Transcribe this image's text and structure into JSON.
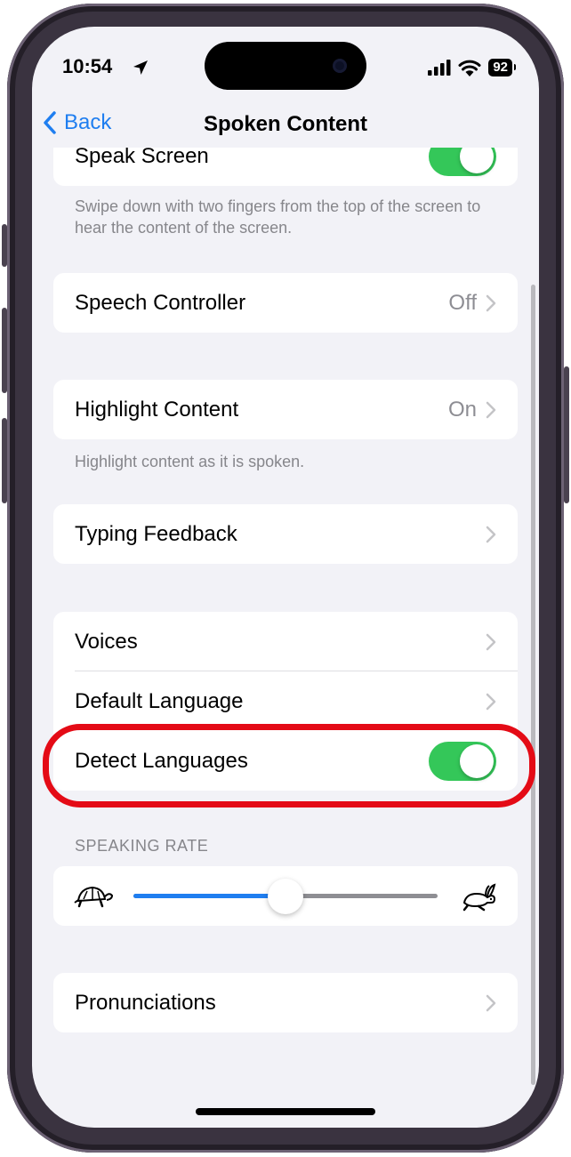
{
  "status": {
    "time": "10:54",
    "battery": "92"
  },
  "nav": {
    "back_label": "Back",
    "title": "Spoken Content"
  },
  "speak_screen": {
    "label": "Speak Screen",
    "enabled": true,
    "footer": "Swipe down with two fingers from the top of the screen to hear the content of the screen."
  },
  "speech_controller": {
    "label": "Speech Controller",
    "value": "Off"
  },
  "highlight_content": {
    "label": "Highlight Content",
    "value": "On",
    "footer": "Highlight content as it is spoken."
  },
  "typing_feedback": {
    "label": "Typing Feedback"
  },
  "voices_group": {
    "voices": "Voices",
    "default_language": "Default Language",
    "detect_languages": "Detect Languages",
    "detect_enabled": true
  },
  "speaking_rate": {
    "header": "SPEAKING RATE",
    "value": 0.5,
    "slow_icon": "turtle-icon",
    "fast_icon": "rabbit-icon"
  },
  "pronunciations": {
    "label": "Pronunciations"
  },
  "colors": {
    "accent": "#1f7ef0",
    "toggle_on": "#34c759",
    "highlight": "#e40b16"
  }
}
